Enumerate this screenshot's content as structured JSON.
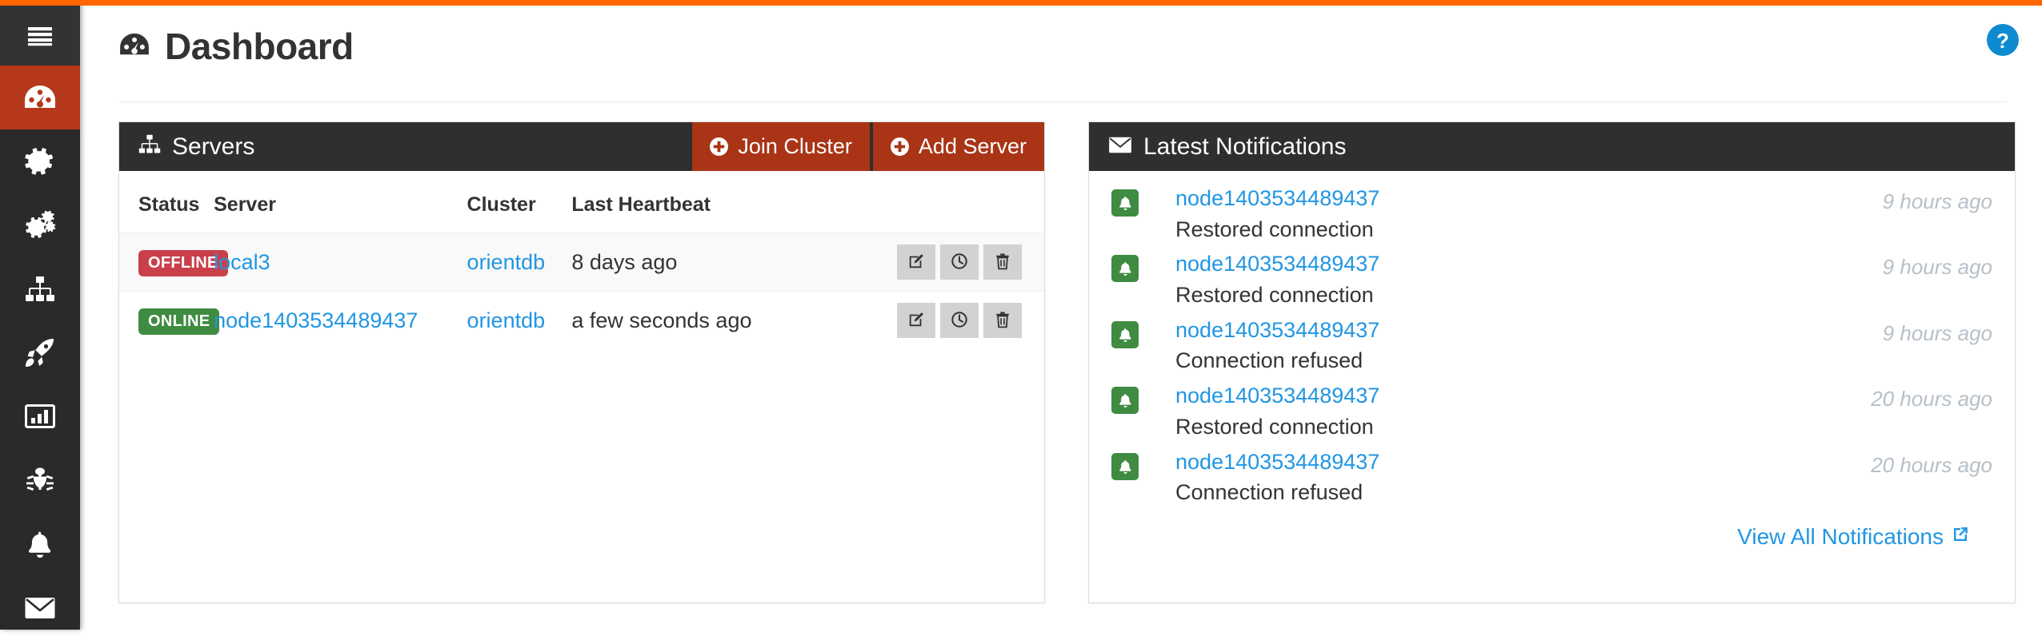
{
  "theme": {
    "accent_orange": "#FF6600",
    "sidebar_bg": "#2a2a2a",
    "sidebar_active": "#b5381b",
    "panel_head_bg": "#2f2f2f",
    "button_red": "#a93416",
    "link_blue": "#2196e3",
    "badge_offline": "#c9404a",
    "badge_online": "#3f8b41",
    "help_blue": "#0e8ad0"
  },
  "sidebar": {
    "items": [
      {
        "icon": "hamburger-menu-icon",
        "name": "menu-toggle",
        "active": false
      },
      {
        "icon": "dashboard-gauge-icon",
        "name": "dashboard",
        "active": true
      },
      {
        "icon": "gear-icon",
        "name": "settings",
        "active": false
      },
      {
        "icon": "cogs-icon",
        "name": "cogs",
        "active": false
      },
      {
        "icon": "sitemap-icon",
        "name": "cluster",
        "active": false
      },
      {
        "icon": "rocket-icon",
        "name": "deploy",
        "active": false
      },
      {
        "icon": "bar-chart-icon",
        "name": "metrics",
        "active": false
      },
      {
        "icon": "bug-icon",
        "name": "debug",
        "active": false
      },
      {
        "icon": "bell-icon",
        "name": "alerts",
        "active": false
      },
      {
        "icon": "envelope-icon",
        "name": "messages",
        "active": false
      }
    ]
  },
  "header": {
    "title": "Dashboard",
    "title_icon": "dashboard-gauge-icon",
    "help_icon": "question-circle-icon"
  },
  "servers_panel": {
    "title": "Servers",
    "title_icon": "sitemap-icon",
    "buttons": [
      {
        "label": "Join Cluster",
        "icon": "plus-circle-icon"
      },
      {
        "label": "Add Server",
        "icon": "plus-circle-icon"
      }
    ],
    "columns": [
      "Status",
      "Server",
      "Cluster",
      "Last Heartbeat",
      ""
    ],
    "rows": [
      {
        "status": "OFFLINE",
        "status_type": "offline",
        "server": "local3",
        "cluster": "orientdb",
        "heartbeat": "8 days ago",
        "actions": [
          "edit-icon",
          "clock-icon",
          "trash-icon"
        ]
      },
      {
        "status": "ONLINE",
        "status_type": "online",
        "server": "node1403534489437",
        "cluster": "orientdb",
        "heartbeat": "a few seconds ago",
        "actions": [
          "edit-icon",
          "clock-icon",
          "trash-icon"
        ]
      }
    ]
  },
  "notifications_panel": {
    "title": "Latest Notifications",
    "title_icon": "envelope-icon",
    "items": [
      {
        "node": "node1403534489437",
        "message": "Restored connection",
        "time": "9 hours ago",
        "icon": "bell-icon"
      },
      {
        "node": "node1403534489437",
        "message": "Restored connection",
        "time": "9 hours ago",
        "icon": "bell-icon"
      },
      {
        "node": "node1403534489437",
        "message": "Connection refused",
        "time": "9 hours ago",
        "icon": "bell-icon"
      },
      {
        "node": "node1403534489437",
        "message": "Restored connection",
        "time": "20 hours ago",
        "icon": "bell-icon"
      },
      {
        "node": "node1403534489437",
        "message": "Connection refused",
        "time": "20 hours ago",
        "icon": "bell-icon"
      }
    ],
    "view_all_label": "View All Notifications",
    "view_all_icon": "external-link-icon"
  }
}
